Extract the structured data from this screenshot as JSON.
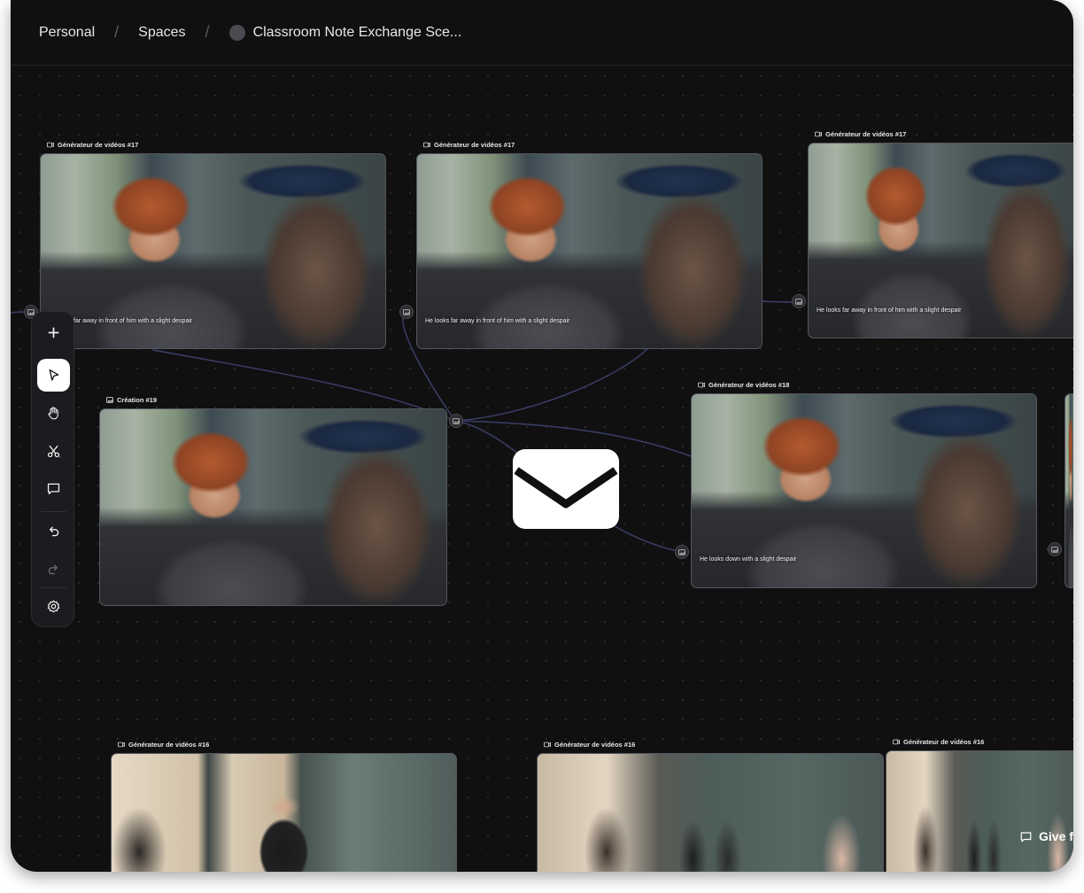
{
  "breadcrumb": {
    "personal": "Personal",
    "separator": "/",
    "spaces": "Spaces",
    "project": "Classroom Note Exchange Sce..."
  },
  "nodes": [
    {
      "title": "Générateur de vidéos #17",
      "caption": "far away in front of him with a slight despair",
      "icon": "video-icon",
      "scene": "boy-closeup"
    },
    {
      "title": "Générateur de vidéos #17",
      "caption": "He looks far away in front of him with a slight despair",
      "icon": "video-icon",
      "scene": "boy-closeup"
    },
    {
      "title": "Générateur de vidéos #17",
      "caption": "He looks far away in front of him with a slight despair",
      "icon": "video-icon",
      "scene": "boy-closeup"
    },
    {
      "title": "Création #19",
      "caption": "",
      "icon": "image-icon",
      "scene": "boy-closeup"
    },
    {
      "title": "Générateur de vidéos #18",
      "caption": "He looks down with a slight despair",
      "icon": "video-icon",
      "scene": "boy-looking-down"
    },
    {
      "title": "Générateur de vidéos #16",
      "caption": "",
      "icon": "video-icon",
      "scene": "classroom-teacher"
    },
    {
      "title": "Générateur de vidéos #16",
      "caption": "",
      "icon": "video-icon",
      "scene": "classroom-students"
    },
    {
      "title": "Générateur de vidéos #16",
      "caption": "",
      "icon": "video-icon",
      "scene": "classroom-students"
    }
  ],
  "toolbar": {
    "tools": [
      "plus-icon",
      "pointer-icon",
      "hand-icon",
      "scissors-icon",
      "comment-icon",
      "undo-icon",
      "redo-icon",
      "settings-icon"
    ],
    "active_tool": "pointer-icon"
  },
  "overlay": {
    "icon": "mail-icon"
  },
  "feedback": {
    "label": "Give f"
  },
  "colors": {
    "background": "#101011",
    "edge": "#3a3f66",
    "text": "#e8e8ea"
  }
}
